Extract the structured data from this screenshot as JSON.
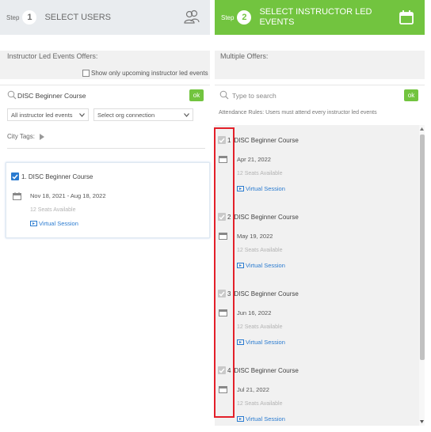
{
  "step1": {
    "step_word": "Step",
    "number": "1",
    "title": "SELECT USERS",
    "icon": "users-icon",
    "offers_label": "Instructor Led Events Offers:",
    "upcoming_label": "Show only upcoming instructor led events",
    "search_value": "DISC Beginner Course",
    "ok_label": "ok",
    "filter_select": "All instructor led events",
    "org_select": "Select org connection",
    "city_tags_label": "City Tags:",
    "event": {
      "title": "1. DISC Beginner Course",
      "date": "Nov 18, 2021 - Aug 18, 2022",
      "seats": "12 Seats Available",
      "link": "Virtual Session"
    }
  },
  "step2": {
    "step_word": "Step",
    "number": "2",
    "title_line1": "SELECT INSTRUCTOR LED",
    "title_line2": "EVENTS",
    "icon": "calendar-icon",
    "offers_label": "Multiple Offers:",
    "search_placeholder": "Type to search",
    "ok_label": "ok",
    "attendance_rules": "Attendance Rules: Users must attend every instructor led events",
    "events": [
      {
        "num": "1",
        "title": "DISC Beginner Course",
        "date": "Apr 21, 2022",
        "seats": "12 Seats Available",
        "link": "Virtual Session"
      },
      {
        "num": "2",
        "title": "DISC Beginner Course",
        "date": "May 19, 2022",
        "seats": "12 Seats Available",
        "link": "Virtual Session"
      },
      {
        "num": "3",
        "title": "DISC Beginner Course",
        "date": "Jun 16, 2022",
        "seats": "12 Seats Available",
        "link": "Virtual Session"
      },
      {
        "num": "4",
        "title": "DISC Beginner Course",
        "date": "Jul 21, 2022",
        "seats": "12 Seats Available",
        "link": "Virtual Session"
      }
    ]
  },
  "colors": {
    "accent_green": "#72c43f",
    "checkbox_blue": "#2a7bd0",
    "highlight_red": "#e3202a"
  }
}
